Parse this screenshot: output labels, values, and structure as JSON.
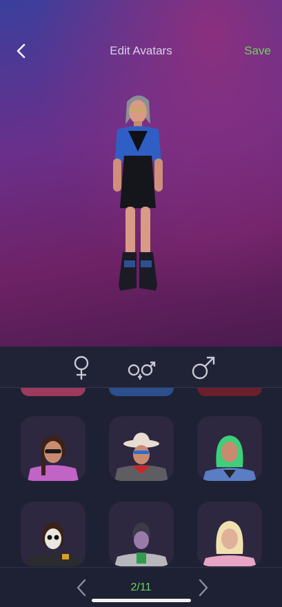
{
  "header": {
    "title": "Edit Avatars",
    "save_label": "Save",
    "back_icon": "chevron-left-icon"
  },
  "gender_filter": {
    "options": [
      {
        "icon": "female-symbol-icon"
      },
      {
        "icon": "nonbinary-symbol-icon"
      },
      {
        "icon": "male-symbol-icon"
      }
    ]
  },
  "avatar_grid": {
    "tiles": [
      {
        "icon": "avatar-thumb-sunglasses-woman"
      },
      {
        "icon": "avatar-thumb-cowboy"
      },
      {
        "icon": "avatar-thumb-green-hair"
      },
      {
        "icon": "avatar-thumb-skull-face"
      },
      {
        "icon": "avatar-thumb-green-shirt"
      },
      {
        "icon": "avatar-thumb-blonde"
      }
    ]
  },
  "pager": {
    "page": "2/11",
    "prev_icon": "chevron-left-icon",
    "next_icon": "chevron-right-icon"
  },
  "colors": {
    "accent": "#6bd65c",
    "background": "#1e2033",
    "tile": "#2d2740"
  }
}
